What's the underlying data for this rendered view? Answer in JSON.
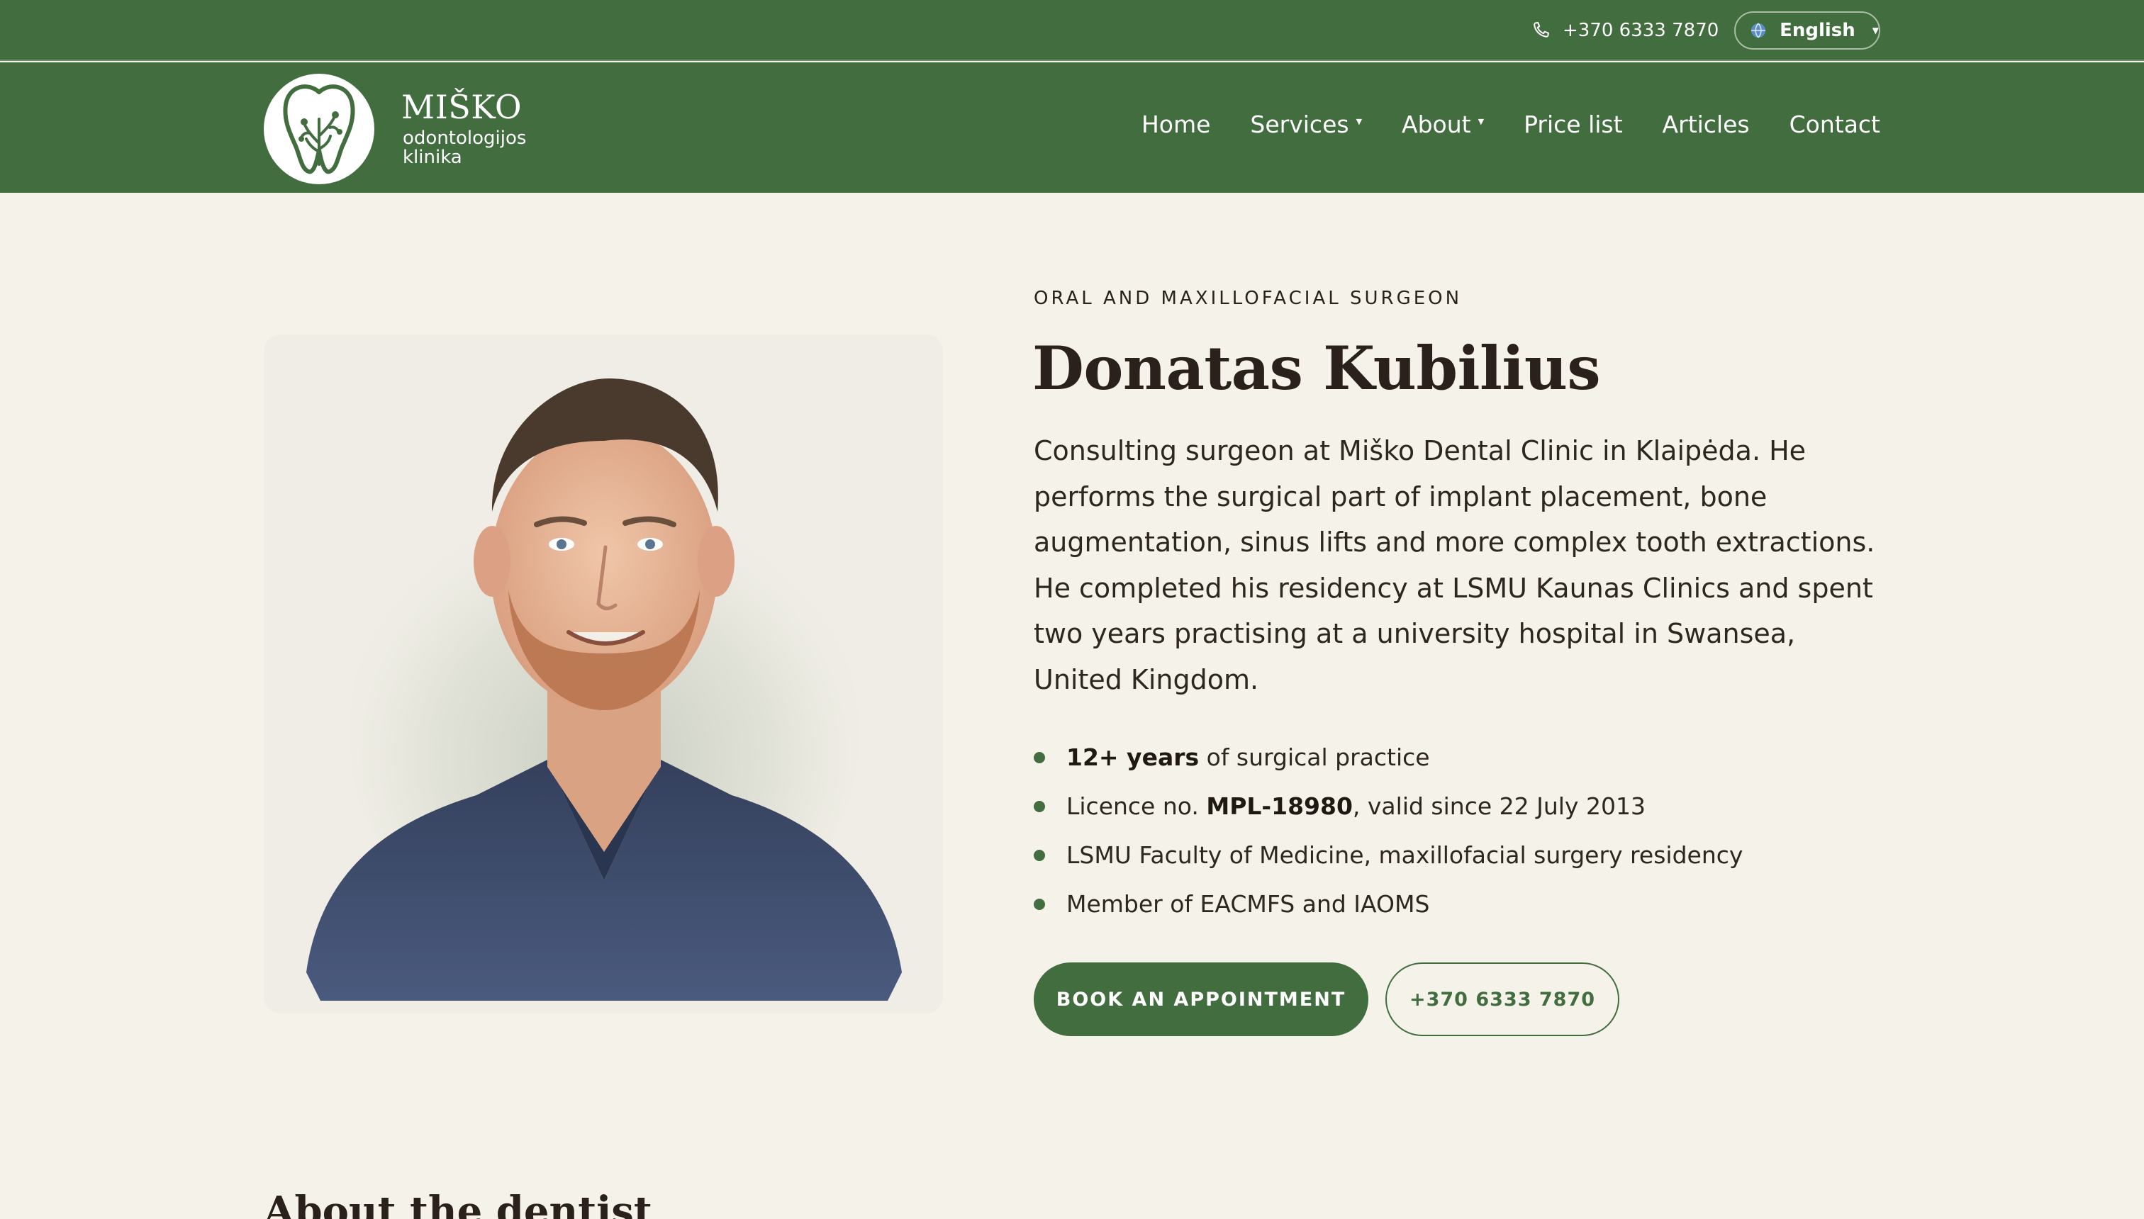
{
  "topbar": {
    "phone": "+370 6333 7870",
    "language": "English",
    "icons": {
      "phone": "phone-icon",
      "language": "globe-icon",
      "dropdown": "chevron-down-icon"
    }
  },
  "brand": {
    "name": "MIŠKO",
    "subtitle": "odontologijos klinika",
    "logo_icon": "tooth-tree-logo"
  },
  "nav": {
    "items": [
      {
        "label": "Home",
        "has_dropdown": false
      },
      {
        "label": "Services",
        "has_dropdown": true
      },
      {
        "label": "About",
        "has_dropdown": true
      },
      {
        "label": "Price list",
        "has_dropdown": false
      },
      {
        "label": "Articles",
        "has_dropdown": false
      },
      {
        "label": "Contact",
        "has_dropdown": false
      }
    ]
  },
  "profile": {
    "eyebrow": "ORAL AND MAXILLOFACIAL SURGEON",
    "name": "Donatas Kubilius",
    "bio": "Consulting surgeon at Miško Dental Clinic in Klaipėda. He performs the surgical part of implant placement, bone augmentation, sinus lifts and more complex tooth extractions. He completed his residency at LSMU Kaunas Clinics and spent two years practising at a university hospital in Swansea, United Kingdom.",
    "facts": [
      {
        "pre": "",
        "strong": "12+ years",
        "post": " of surgical practice"
      },
      {
        "pre": "Licence no. ",
        "strong": "MPL-18980",
        "post": ", valid since 22 July 2013"
      },
      {
        "pre": "LSMU Faculty of Medicine, maxillofacial surgery residency",
        "strong": "",
        "post": ""
      },
      {
        "pre": "Member of EACMFS and IAOMS",
        "strong": "",
        "post": ""
      }
    ],
    "book_label": "BOOK AN APPOINTMENT",
    "phone_label": "+370 6333 7870"
  },
  "next_section": {
    "title": "About the dentist"
  },
  "colors": {
    "brand_green": "#416d3f",
    "page_bg": "#f5f2e9",
    "text_dark": "#2a211c",
    "white": "#ffffff"
  }
}
